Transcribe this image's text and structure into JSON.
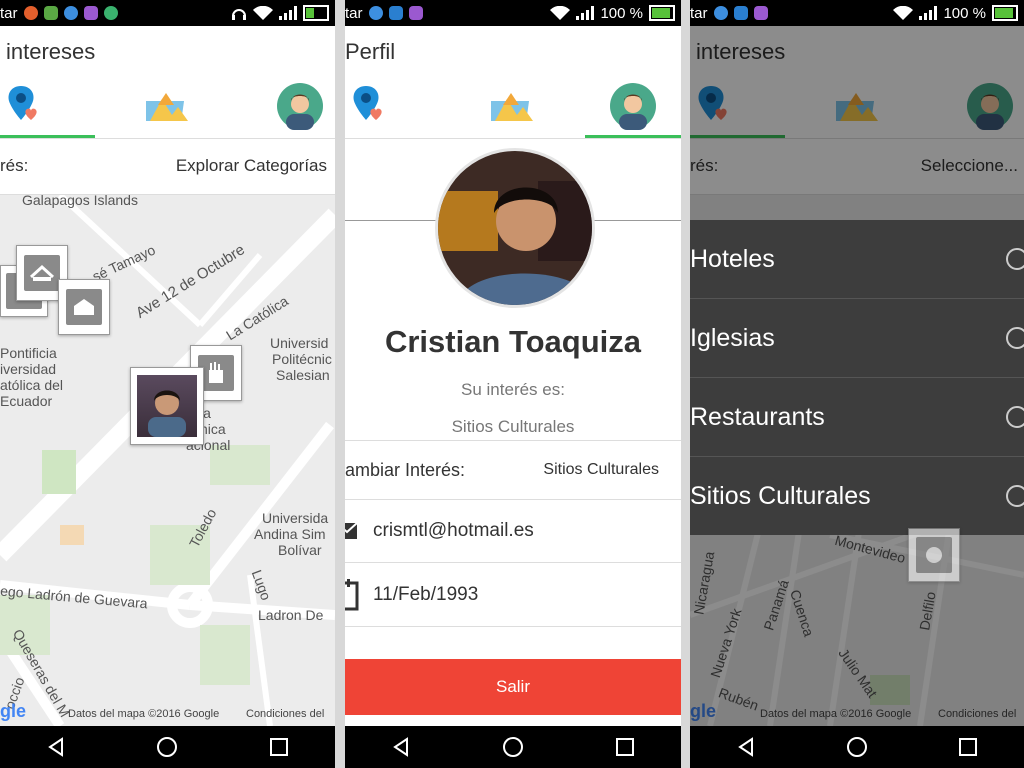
{
  "status": {
    "carrier": "tar",
    "battery": "100 %"
  },
  "screen1": {
    "title": "intereses",
    "filter_label": "rés:",
    "filter_value": "Explorar Categorías",
    "map_labels": [
      "Galapagos Islands",
      "sé Tamayo",
      "Ave 12 de Octubre",
      "La Católica",
      "Pontificia",
      "iversidad",
      "atólica del",
      "Ecuador",
      "Universid",
      "Politécnic",
      "Salesian",
      "la",
      "nica",
      "acional",
      "Universida",
      "Andina Sim",
      "Bolívar",
      "Toledo",
      "Lugo",
      "ego Ladrón de Guevara",
      "Ladron De",
      "Queseras del M",
      "occio"
    ],
    "attribution": "Datos del mapa ©2016 Google",
    "terms": "Condiciones del"
  },
  "screen2": {
    "title": "Perfil",
    "name": "Cristian Toaquiza",
    "interest_label": "Su interés es:",
    "interest_value": "Sitios Culturales",
    "change_label": "ambiar Interés:",
    "change_value": "Sitios Culturales",
    "email": "crismtl@hotmail.es",
    "birthdate": "11/Feb/1993",
    "logout": "Salir"
  },
  "screen3": {
    "title": "intereses",
    "filter_label": "rés:",
    "filter_value": "Seleccione...",
    "options": [
      "Hoteles",
      "Iglesias",
      "Restaurants",
      "Sitios Culturales"
    ],
    "map_labels": [
      "Montevideo",
      "Nicaragua",
      "Panamá",
      "Cuenca",
      "Nueva York",
      "Delfilo",
      "Julio Mat",
      "Rubén"
    ],
    "attribution": "Datos del mapa ©2016 Google",
    "terms": "Condiciones del"
  },
  "icons": {
    "status_left": [
      "sim-icon",
      "game-icon",
      "vpn-icon",
      "photo-icon",
      "android-icon"
    ],
    "status_right": [
      "headphones-icon",
      "wifi-icon",
      "signal-icon",
      "battery-icon"
    ],
    "tabs": [
      "location-heart-icon",
      "landscape-icon",
      "profile-avatar-icon"
    ],
    "nav": [
      "back-icon",
      "home-icon",
      "recents-icon"
    ]
  },
  "colors": {
    "accent_green": "#3bbf5a",
    "logout_red": "#ef4436",
    "dialog_bg": "#3d3d3d",
    "map_bg": "#ececec"
  }
}
